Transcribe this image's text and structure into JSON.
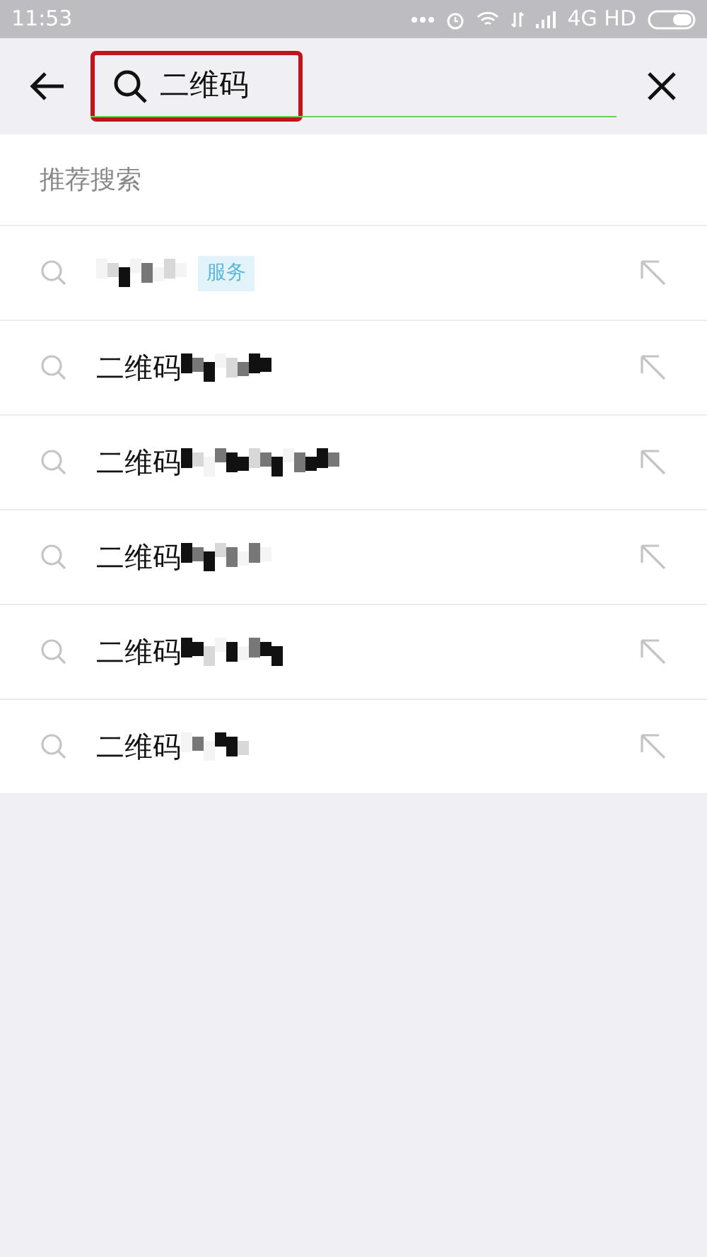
{
  "status_bar": {
    "time": "11:53",
    "network": "4G HD"
  },
  "search": {
    "value": "二维码",
    "highlighted": true
  },
  "section_title": "推荐搜索",
  "suggestions": [
    {
      "obscured": true,
      "badge": "服务"
    },
    {
      "text": "二维码",
      "obscured": true
    },
    {
      "text": "二维码",
      "obscured": true
    },
    {
      "text": "二维码",
      "obscured": true
    },
    {
      "text": "二维码",
      "obscured": true
    },
    {
      "text": "二维码",
      "obscured": true
    }
  ]
}
